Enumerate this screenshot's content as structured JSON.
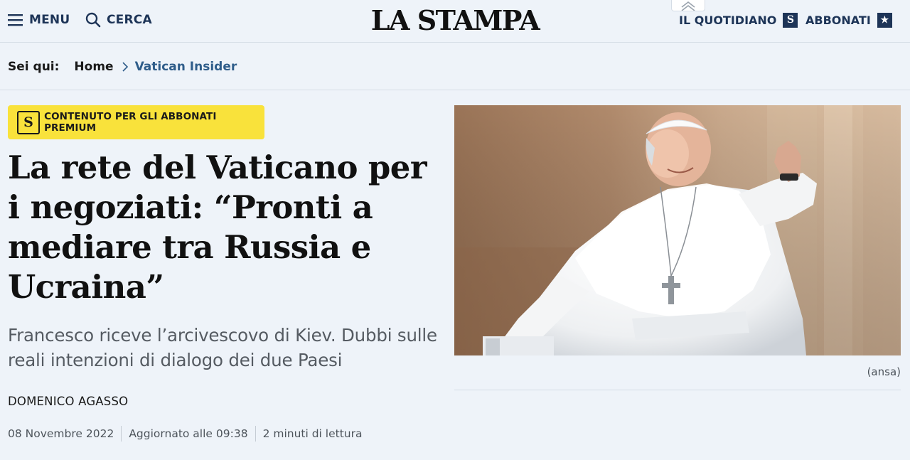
{
  "header": {
    "menu_label": "MENU",
    "search_label": "CERCA",
    "logo": "LA STAMPA",
    "quotidiano_label": "IL QUOTIDIANO",
    "quotidiano_badge": "S",
    "abbonati_label": "ABBONATI",
    "abbonati_badge": "★",
    "icons": [
      "menu-icon",
      "search-icon",
      "chevron-up-double-icon",
      "newspaper-s-icon",
      "star-icon"
    ],
    "brand_color": "#1d3457"
  },
  "breadcrumb": {
    "label": "Sei qui:",
    "home": "Home",
    "separator_icon": "chevron-right-icon",
    "current": "Vatican Insider",
    "current_color": "#2f5d8a"
  },
  "article": {
    "premium_badge_letter": "S",
    "premium_badge_text": "CONTENUTO PER GLI ABBONATI PREMIUM",
    "premium_color": "#f9e23b",
    "headline": "La rete del Vaticano per i negoziati: “Pronti a mediare tra Russia e Ucraina”",
    "subtitle": "Francesco riceve l’arcivescovo di Kiev. Dubbi sulle reali intenzioni di dialogo dei due Paesi",
    "author": "DOMENICO AGASSO",
    "date": "08 Novembre 2022",
    "updated": "Aggiornato alle 09:38",
    "reading_time": "2 minuti di lettura"
  },
  "image": {
    "caption": "(ansa)"
  }
}
